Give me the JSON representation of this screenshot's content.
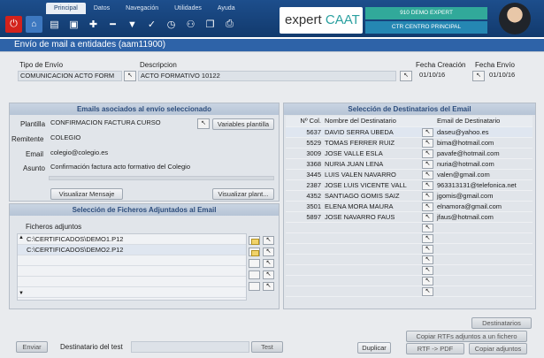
{
  "menu": {
    "tabs": [
      "Principal",
      "Datos",
      "Navegación",
      "Utilidades",
      "Ayuda"
    ],
    "active_tab": "Principal"
  },
  "toolbar": {
    "icons": [
      "file-icon",
      "save-icon",
      "add-icon",
      "remove-icon",
      "filter-icon",
      "check-icon",
      "history-icon",
      "group-icon",
      "copy-icon",
      "print-icon"
    ]
  },
  "brand": {
    "prefix": "expert ",
    "suffix": "CAAT"
  },
  "session": {
    "line1": "910 DEMO EXPERT",
    "line2": "CTR CENTRO PRINCIPAL"
  },
  "window": {
    "title": "Envío de mail a entidades (aam11900)"
  },
  "header": {
    "tipo_label": "Tipo de Envío",
    "tipo_value": "COMUNICACION ACTO FORM",
    "descripcion_label": "Descripcion",
    "descripcion_value": "ACTO FORMATIVO 10122",
    "fecha_creacion_label": "Fecha Creación",
    "fecha_creacion_value": "01/10/16",
    "fecha_envio_label": "Fecha Envío",
    "fecha_envio_value": "01/10/16"
  },
  "emails_panel": {
    "title": "Emails asociados al envío seleccionado",
    "plantilla_label": "Plantilla",
    "plantilla_value": "CONFIRMACION FACTURA CURSO",
    "variables_button": "Variables plantilla",
    "remitente_label": "Remitente",
    "remitente_value": "COLEGIO",
    "email_label": "Email",
    "email_value": "colegio@colegio.es",
    "asunto_label": "Asunto",
    "asunto_value": "Confirmación factura acto formativo del Colegio",
    "visualizar_mensaje": "Visualizar Mensaje",
    "visualizar_plant": "Visualizar plant..."
  },
  "files_panel": {
    "title": "Selección de Ficheros Adjuntados al Email",
    "list_label": "Ficheros adjuntos",
    "files": [
      "C:\\CERTIFICADOS\\DEMO1.P12",
      "C:\\CERTIFICADOS\\DEMO2.P12",
      "",
      "",
      "",
      ""
    ]
  },
  "recipients_panel": {
    "title": "Selección de Destinatarios del Email",
    "col_num": "Nº Col.",
    "col_name": "Nombre del Destinatario",
    "col_email": "Email de Destinatario",
    "rows": [
      {
        "num": "5637",
        "name": "DAVID SERRA UBEDA",
        "email": "daseu@yahoo.es"
      },
      {
        "num": "5529",
        "name": "TOMAS FERRER RUIZ",
        "email": "bima@hotmail.com"
      },
      {
        "num": "3009",
        "name": "JOSE VALLE ESLA",
        "email": "pavafe@hotmail.com"
      },
      {
        "num": "3368",
        "name": "NURIA JUAN LENA",
        "email": "nuria@hotmail.com"
      },
      {
        "num": "3445",
        "name": "LUIS VALEN NAVARRO",
        "email": "valen@gmail.com"
      },
      {
        "num": "2387",
        "name": "JOSE LUIS VICENTE VALL",
        "email": "963313131@telefonica.net"
      },
      {
        "num": "4352",
        "name": "SANTIAGO GOMIS SAIZ",
        "email": "jgomis@gmail.com"
      },
      {
        "num": "3501",
        "name": "ELENA MORA MAURA",
        "email": "elnamora@gmail.com"
      },
      {
        "num": "5897",
        "name": "JOSE NAVARRO FAUS",
        "email": "jfaus@hotmail.com"
      },
      {
        "num": "",
        "name": "",
        "email": ""
      },
      {
        "num": "",
        "name": "",
        "email": ""
      },
      {
        "num": "",
        "name": "",
        "email": ""
      },
      {
        "num": "",
        "name": "",
        "email": ""
      },
      {
        "num": "",
        "name": "",
        "email": ""
      },
      {
        "num": "",
        "name": "",
        "email": ""
      },
      {
        "num": "",
        "name": "",
        "email": ""
      }
    ]
  },
  "footer": {
    "enviar": "Enviar",
    "dest_test_label": "Destinatario del test",
    "test_button": "Test",
    "duplicar": "Duplicar",
    "destinatarios": "Destinatarios",
    "copiar_rtfs": "Copiar RTFs adjuntos a un fichero",
    "rtf_pdf": "RTF -> PDF",
    "copiar_adjuntos": "Copiar adjuntos"
  },
  "colors": {
    "topbar": "#1d4e8c",
    "window_bar": "#2e63a8",
    "accent_teal": "#31a99a",
    "power_red": "#d3221c"
  }
}
